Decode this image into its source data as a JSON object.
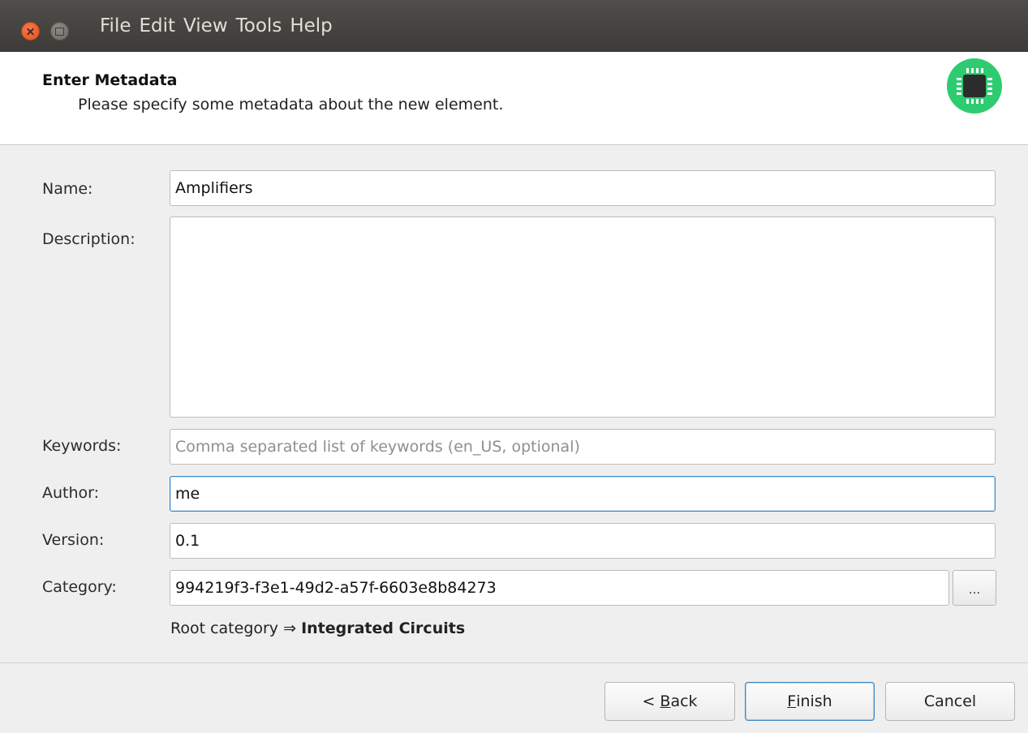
{
  "window": {
    "menu": [
      "File",
      "Edit",
      "View",
      "Tools",
      "Help"
    ]
  },
  "header": {
    "title": "Enter Metadata",
    "subtitle": "Please specify some metadata about the new element.",
    "logo_color": "#2ecc71"
  },
  "form": {
    "name": {
      "label": "Name:",
      "value": "Amplifiers"
    },
    "description": {
      "label": "Description:",
      "value": ""
    },
    "keywords": {
      "label": "Keywords:",
      "value": "",
      "placeholder": "Comma separated list of keywords (en_US, optional)"
    },
    "author": {
      "label": "Author:",
      "value": "me"
    },
    "version": {
      "label": "Version:",
      "value": "0.1"
    },
    "category": {
      "label": "Category:",
      "value": "994219f3-f3e1-49d2-a57f-6603e8b84273",
      "browse_label": "...",
      "hint_prefix": "Root category ⇒ ",
      "hint_name": "Integrated Circuits"
    }
  },
  "buttons": {
    "back": {
      "prefix": "< ",
      "mnemonic": "B",
      "rest": "ack"
    },
    "finish": {
      "prefix": "",
      "mnemonic": "F",
      "rest": "inish"
    },
    "cancel": {
      "label": "Cancel"
    }
  },
  "colors": {
    "focus_border": "#3b86c4",
    "titlebar": "#3c3b37",
    "close_button": "#e5501d"
  }
}
